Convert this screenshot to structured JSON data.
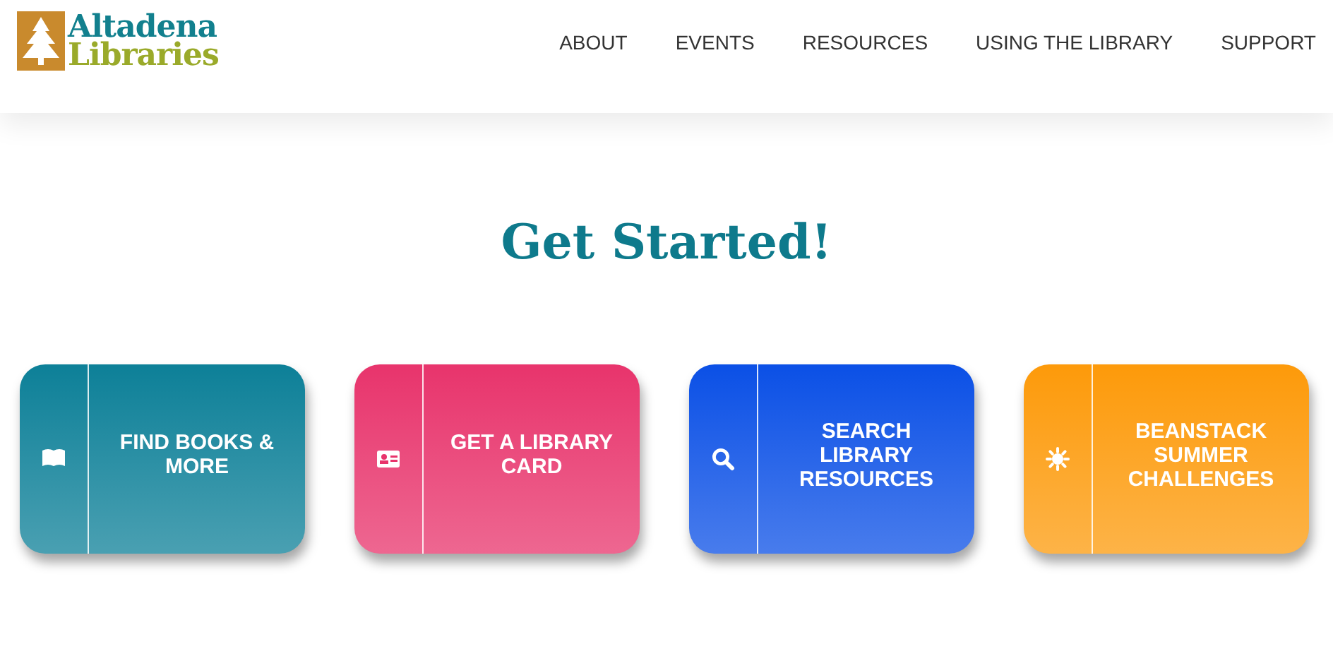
{
  "logo": {
    "line_1": "Altadena",
    "line_2": "Libraries"
  },
  "nav": [
    "ABOUT",
    "EVENTS",
    "RESOURCES",
    "USING THE LIBRARY",
    "SUPPORT"
  ],
  "heading": "Get Started!",
  "cards": [
    {
      "kind": "book",
      "label": "FIND BOOKS & MORE",
      "color": "#0d8098"
    },
    {
      "kind": "card",
      "label": "GET A LIBRARY CARD",
      "color": "#e8346c"
    },
    {
      "kind": "search",
      "label": "SEARCH LIBRARY RESOURCES",
      "color": "#0b50e6"
    },
    {
      "kind": "sun",
      "label": "BEANSTACK SUMMER CHALLENGES",
      "color": "#fd9a0a"
    }
  ]
}
